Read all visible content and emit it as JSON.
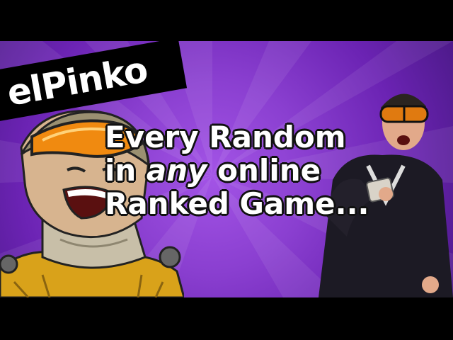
{
  "channel": {
    "name": "elPinko"
  },
  "caption": {
    "line1": "Every Random",
    "line2_prefix": "in ",
    "line2_emphasis": "any",
    "line2_suffix": " online",
    "line3": "Ranked Game..."
  },
  "colors": {
    "background": "#8a3fd0",
    "badge": "#000000",
    "text": "#ffffff",
    "letterbox": "#000000"
  },
  "icons": {
    "left": "cartoon-laughing-character",
    "right": "man-with-goggles-photo"
  }
}
